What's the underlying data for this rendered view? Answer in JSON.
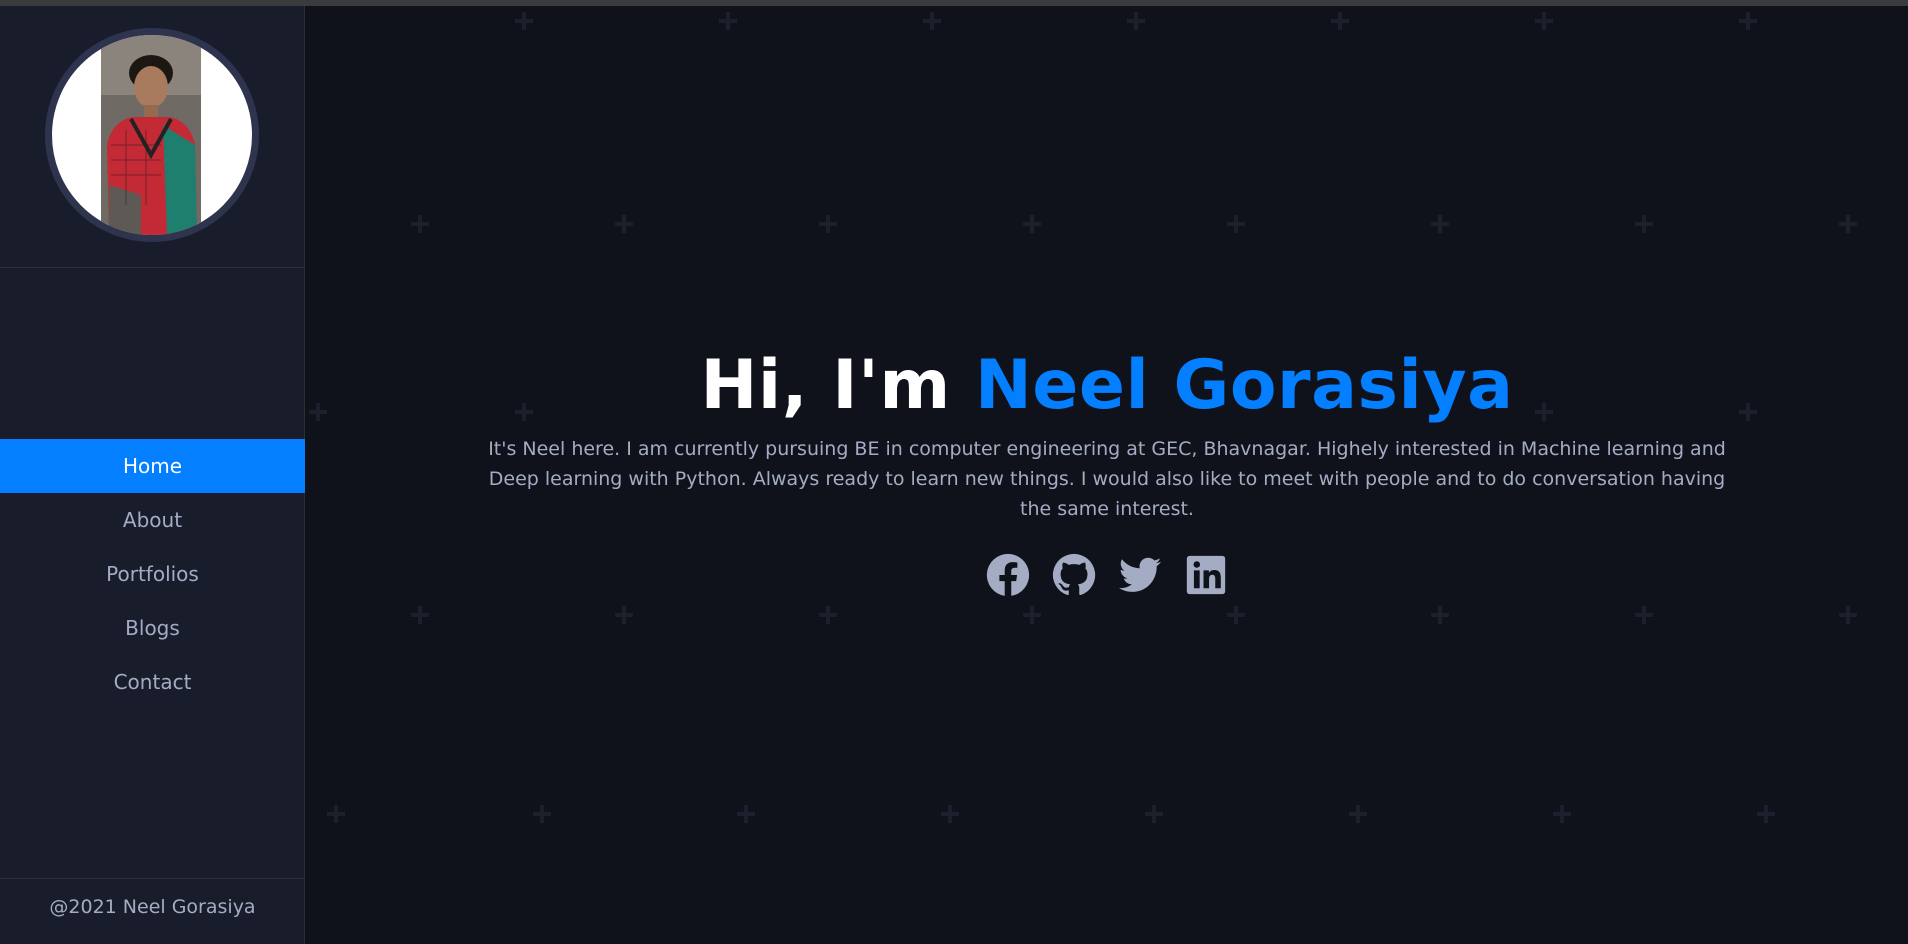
{
  "profile": {
    "photo_alt": "Profile photo"
  },
  "nav": {
    "items": [
      {
        "label": "Home",
        "active": true
      },
      {
        "label": "About",
        "active": false
      },
      {
        "label": "Portfolios",
        "active": false
      },
      {
        "label": "Blogs",
        "active": false
      },
      {
        "label": "Contact",
        "active": false
      }
    ]
  },
  "footer": {
    "copyright": "@2021 Neel Gorasiya"
  },
  "hero": {
    "greeting": "Hi, I'm ",
    "name": "Neel Gorasiya",
    "bio": "It's Neel here. I am currently pursuing BE in computer engineering at GEC, Bhavnagar. Highely interested in Machine learning and Deep learning with Python. Always ready to learn new things. I would also like to meet with people and to do conversation having the same interest."
  },
  "socials": [
    {
      "icon": "facebook-icon"
    },
    {
      "icon": "github-icon"
    },
    {
      "icon": "twitter-icon"
    },
    {
      "icon": "linkedin-icon"
    }
  ],
  "colors": {
    "accent": "#037fff",
    "background": "#10121b",
    "sidebar": "#191d2b",
    "text": "#a4acc4",
    "heading": "#ffffff"
  }
}
